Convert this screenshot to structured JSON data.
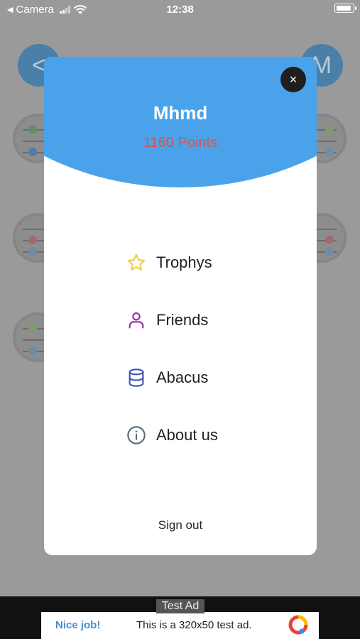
{
  "status_bar": {
    "back_app": "Camera",
    "time": "12:38"
  },
  "background": {
    "left_button_glyph": "<",
    "right_avatar_initial": "M"
  },
  "profile": {
    "name": "Mhmd",
    "points": "1160 Points",
    "close_glyph": "×"
  },
  "menu": [
    {
      "label": "Trophys",
      "icon": "star-icon",
      "color": "#f2c94c"
    },
    {
      "label": "Friends",
      "icon": "person-icon",
      "color": "#9c27b0"
    },
    {
      "label": "Abacus",
      "icon": "database-icon",
      "color": "#3f51b5"
    },
    {
      "label": "About us",
      "icon": "info-icon",
      "color": "#546e7a"
    }
  ],
  "sign_out": "Sign out",
  "ad": {
    "tag": "Test Ad",
    "headline": "Nice job!",
    "text": "This is a 320x50 test ad."
  },
  "colors": {
    "header_blue": "#4aa3ea",
    "points_red": "#d9534f"
  }
}
